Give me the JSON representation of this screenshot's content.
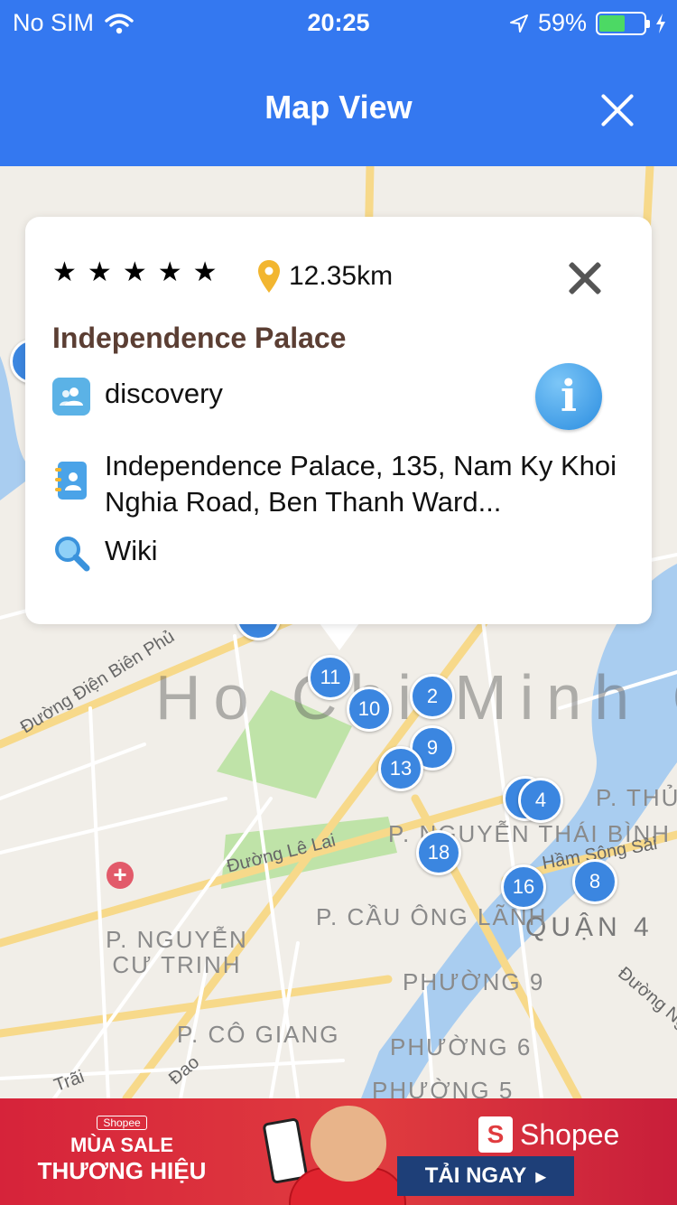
{
  "status_bar": {
    "carrier": "No SIM",
    "time": "20:25",
    "battery": "59%",
    "battery_level": 0.59
  },
  "nav": {
    "title": "Map View",
    "close_icon": "close-icon"
  },
  "callout": {
    "rating": 5,
    "stars": [
      "★",
      "★",
      "★",
      "★",
      "★"
    ],
    "distance": "12.35km",
    "title": "Independence Palace",
    "category": "discovery",
    "address": "Independence Palace, 135, Nam Ky Khoi Nghia Road, Ben Thanh Ward...",
    "wiki": "Wiki",
    "info_glyph": "i",
    "colors": {
      "title": "#5b3e33",
      "pin": "#f2b630",
      "info": "#2b8de0"
    }
  },
  "map": {
    "city_label": "Ho Chi Minh C",
    "district_label": "QUẬN 4",
    "area_labels": [
      "P. NGUYỄN THÁI BÌNH",
      "P. CẦU ÔNG LÃNH",
      "P. NGUYỄN CƯ TRINH",
      "PHƯỜNG 9",
      "P. CÔ GIANG",
      "PHƯỜNG 6",
      "PHƯỜNG 5",
      "P. THỦ"
    ],
    "road_labels": [
      "Đường Điện Biên Phủ",
      "Đường Lê Lai",
      "Hầm Sông Sài",
      "Đường Ng",
      "Trãi",
      "Đao"
    ],
    "markers": [
      "11",
      "10",
      "2",
      "9",
      "13",
      "4",
      "18",
      "16",
      "8"
    ],
    "accent": "#3b86e0"
  },
  "ad": {
    "tag": "Shopee",
    "line1": "MÙA SALE",
    "line2": "THƯƠNG HIỆU",
    "brand": "Shopee",
    "bag_glyph": "S",
    "cta": "TẢI NGAY",
    "cta_arrow": "▸"
  }
}
